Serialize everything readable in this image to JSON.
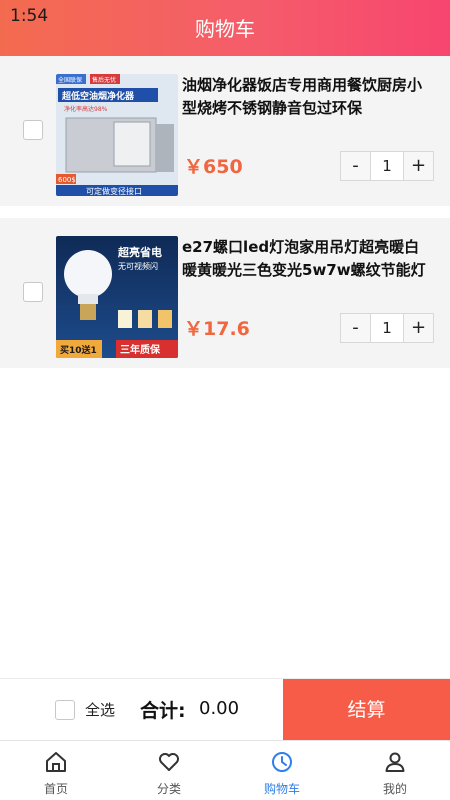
{
  "status": {
    "time": "1:54"
  },
  "header": {
    "title": "购物车"
  },
  "cart": {
    "items": [
      {
        "title": "油烟净化器饭店专用商用餐饮厨房小型烧烤不锈钢静音包过环保",
        "price": "￥650",
        "quantity": "1",
        "minus": "-",
        "plus": "+",
        "image_text": {
          "badge_left": "全国联保",
          "badge_right": "售后无忧",
          "headline": "超低空油烟净化器",
          "sub": "净化率高达98%",
          "price_tag": "600$",
          "footer": "可定做变径接口"
        }
      },
      {
        "title": "e27螺口led灯泡家用吊灯超亮暖白暖黄暖光三色变光5w7w螺纹节能灯",
        "price": "￥17.6",
        "quantity": "1",
        "minus": "-",
        "plus": "+",
        "image_text": {
          "headline": "超亮省电",
          "sub": "无可视频闪",
          "promo": "买10送1",
          "warranty": "三年质保"
        }
      }
    ]
  },
  "checkout": {
    "select_all": "全选",
    "total_label": "合计:",
    "total_value": "0.00",
    "button": "结算"
  },
  "tabbar": {
    "tabs": [
      {
        "label": "首页",
        "icon": "home-icon"
      },
      {
        "label": "分类",
        "icon": "heart-icon"
      },
      {
        "label": "购物车",
        "icon": "cart-icon"
      },
      {
        "label": "我的",
        "icon": "user-icon"
      }
    ],
    "active_color": "#2f7ee9"
  },
  "colors": {
    "accent": "#f75c48",
    "price": "#f1653f"
  }
}
